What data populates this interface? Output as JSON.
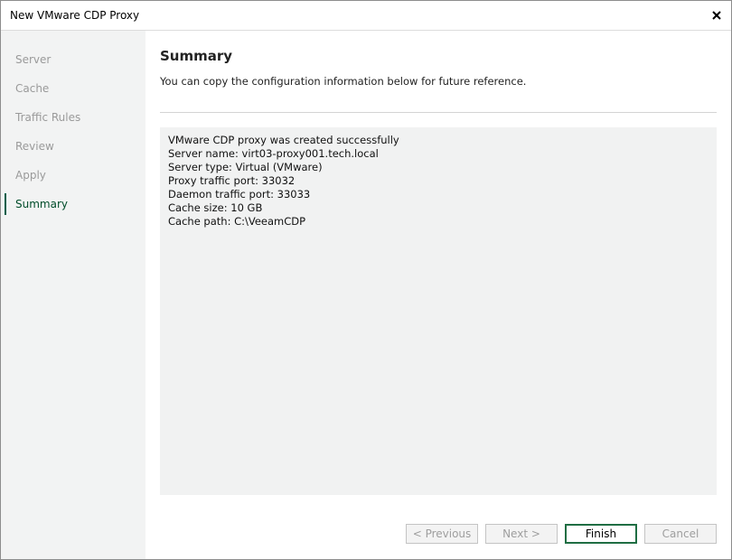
{
  "window": {
    "title": "New VMware CDP Proxy",
    "close_icon": "close-icon"
  },
  "sidebar": {
    "steps": [
      {
        "label": "Server"
      },
      {
        "label": "Cache"
      },
      {
        "label": "Traffic Rules"
      },
      {
        "label": "Review"
      },
      {
        "label": "Apply"
      },
      {
        "label": "Summary"
      }
    ],
    "active": "Summary"
  },
  "main": {
    "heading": "Summary",
    "subheading": "You can copy the configuration information below for future reference.",
    "summary_lines": [
      "VMware CDP proxy was created successfully",
      "Server name: virt03-proxy001.tech.local",
      "Server type: Virtual (VMware)",
      "Proxy traffic port: 33032",
      "Daemon traffic port: 33033",
      "Cache size: 10 GB",
      "Cache path: C:\\VeeamCDP"
    ]
  },
  "buttons": {
    "previous": "< Previous",
    "next": "Next >",
    "finish": "Finish",
    "cancel": "Cancel"
  },
  "colors": {
    "accent": "#1f6e43",
    "sidebar_bg": "#f2f3f3",
    "summary_bg": "#f1f2f2"
  }
}
